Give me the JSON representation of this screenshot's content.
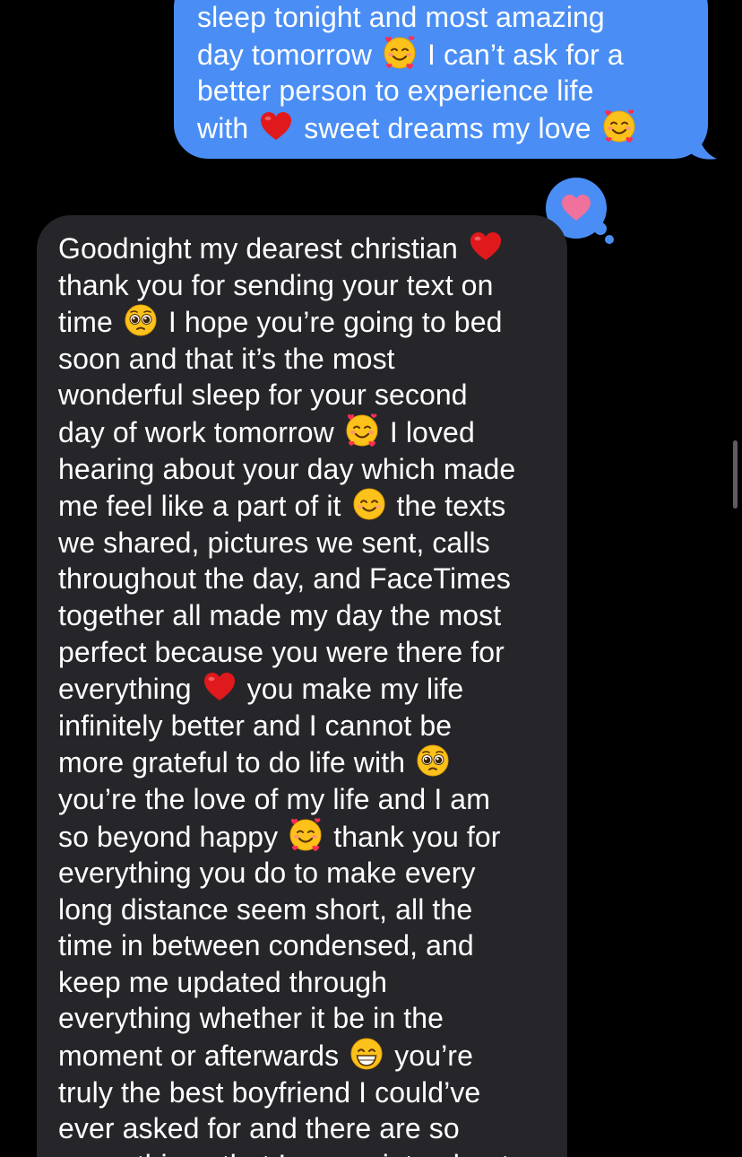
{
  "conversation": {
    "sent_message": {
      "lines": [
        [
          {
            "t": "sleep tonight and most amazing"
          }
        ],
        [
          {
            "t": "day tomorrow "
          },
          {
            "e": "smiling-face-with-hearts"
          },
          {
            "t": " I can’t ask for a"
          }
        ],
        [
          {
            "t": "better person to experience life"
          }
        ],
        [
          {
            "t": "with "
          },
          {
            "e": "red-heart"
          },
          {
            "t": " sweet dreams my love "
          },
          {
            "e": "smiling-face-with-hearts"
          }
        ]
      ]
    },
    "tapback": {
      "icon": "heart-tapback-icon",
      "color": "#f0719b"
    },
    "received_message": {
      "lines": [
        [
          {
            "t": "Goodnight my dearest christian "
          },
          {
            "e": "red-heart"
          }
        ],
        [
          {
            "t": "thank you for sending your text on"
          }
        ],
        [
          {
            "t": "time "
          },
          {
            "e": "pleading-face"
          },
          {
            "t": " I hope you’re going to bed"
          }
        ],
        [
          {
            "t": "soon and that it’s the most"
          }
        ],
        [
          {
            "t": "wonderful sleep for your second"
          }
        ],
        [
          {
            "t": "day of work tomorrow "
          },
          {
            "e": "smiling-face-with-hearts"
          },
          {
            "t": " I loved"
          }
        ],
        [
          {
            "t": "hearing about your day which made"
          }
        ],
        [
          {
            "t": "me feel like a part of it "
          },
          {
            "e": "smiling-face"
          },
          {
            "t": " the texts"
          }
        ],
        [
          {
            "t": "we shared, pictures we sent, calls"
          }
        ],
        [
          {
            "t": "throughout the day, and FaceTimes"
          }
        ],
        [
          {
            "t": "together all made my day the most"
          }
        ],
        [
          {
            "t": "perfect because you were there for"
          }
        ],
        [
          {
            "t": "everything "
          },
          {
            "e": "red-heart"
          },
          {
            "t": " you make my life"
          }
        ],
        [
          {
            "t": "infinitely better and I cannot be"
          }
        ],
        [
          {
            "t": "more grateful to do life with "
          },
          {
            "e": "pleading-face"
          }
        ],
        [
          {
            "t": "you’re the love of my life and I am"
          }
        ],
        [
          {
            "t": "so beyond happy "
          },
          {
            "e": "smiling-face-with-hearts"
          },
          {
            "t": " thank you for"
          }
        ],
        [
          {
            "t": "everything you do to make every"
          }
        ],
        [
          {
            "t": "long distance seem short, all the"
          }
        ],
        [
          {
            "t": "time in between condensed, and"
          }
        ],
        [
          {
            "t": "keep me updated through"
          }
        ],
        [
          {
            "t": "everything whether it be in the"
          }
        ],
        [
          {
            "t": "moment or afterwards "
          },
          {
            "e": "grinning-face"
          },
          {
            "t": " you’re"
          }
        ],
        [
          {
            "t": "truly the best boyfriend I could’ve"
          }
        ],
        [
          {
            "t": "ever asked for and there are so"
          }
        ],
        [
          {
            "t": "many things that I appreciate about"
          }
        ]
      ]
    }
  },
  "colors": {
    "background": "#000000",
    "sent_bubble": "#4a8ef5",
    "received_bubble": "#26262a",
    "text": "#ffffff"
  }
}
